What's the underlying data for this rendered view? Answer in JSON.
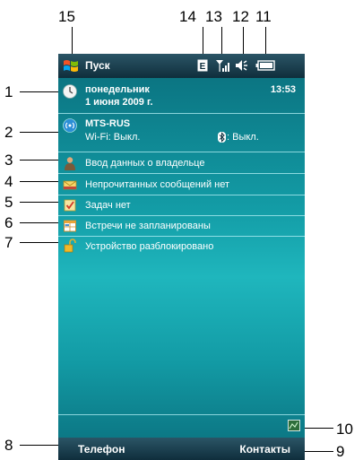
{
  "callouts": [
    "1",
    "2",
    "3",
    "4",
    "5",
    "6",
    "7",
    "8",
    "9",
    "10",
    "11",
    "12",
    "13",
    "14",
    "15"
  ],
  "topbar": {
    "start_label": "Пуск",
    "icons": [
      "windows-flag-icon",
      "e-data-icon",
      "signal-icon",
      "speaker-icon",
      "battery-icon"
    ]
  },
  "date": {
    "weekday": "понедельник",
    "date": "1 июня 2009 г.",
    "time": "13:53"
  },
  "network": {
    "operator": "MTS-RUS",
    "wifi": "Wi-Fi: Выкл.",
    "bluetooth": ": Выкл."
  },
  "items": [
    {
      "label": "Ввод данных о владельце",
      "icon": "owner-icon"
    },
    {
      "label": "Непрочитанных сообщений нет",
      "icon": "mail-icon"
    },
    {
      "label": "Задач нет",
      "icon": "tasks-icon"
    },
    {
      "label": "Встречи не запланированы",
      "icon": "calendar-icon"
    },
    {
      "label": "Устройство разблокировано",
      "icon": "lock-icon"
    }
  ],
  "softkeys": {
    "left": "Телефон",
    "right": "Контакты"
  },
  "colors": {
    "bg_top": "#0a6e7c",
    "bg_mid": "#1fb6bd",
    "bar": "#0f2e3c",
    "separator": "#b4f0f5"
  }
}
